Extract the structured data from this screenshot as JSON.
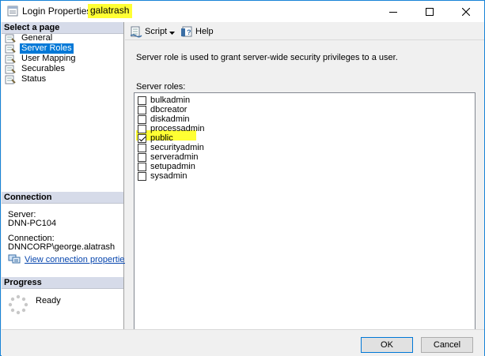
{
  "window": {
    "title": "Login Properties - ",
    "login_name": "galatrash"
  },
  "left_panel": {
    "select_page_header": "Select a page",
    "pages": [
      {
        "label": "General",
        "selected": false
      },
      {
        "label": "Server Roles",
        "selected": true
      },
      {
        "label": "User Mapping",
        "selected": false
      },
      {
        "label": "Securables",
        "selected": false
      },
      {
        "label": "Status",
        "selected": false
      }
    ],
    "connection_header": "Connection",
    "server_label": "Server:",
    "server_value": "DNN-PC104",
    "connection_label": "Connection:",
    "connection_value": "DNNCORP\\george.alatrash",
    "view_connection_link": "View connection properties",
    "progress_header": "Progress",
    "progress_status": "Ready"
  },
  "toolbar": {
    "script_label": "Script",
    "help_label": "Help"
  },
  "main": {
    "description": "Server role is used to grant server-wide security privileges to a user.",
    "roles_label": "Server roles:",
    "roles": [
      {
        "label": "bulkadmin",
        "checked": false
      },
      {
        "label": "dbcreator",
        "checked": false
      },
      {
        "label": "diskadmin",
        "checked": false
      },
      {
        "label": "processadmin",
        "checked": false
      },
      {
        "label": "public",
        "checked": true
      },
      {
        "label": "securityadmin",
        "checked": false
      },
      {
        "label": "serveradmin",
        "checked": false
      },
      {
        "label": "setupadmin",
        "checked": false
      },
      {
        "label": "sysadmin",
        "checked": false
      }
    ]
  },
  "buttons": {
    "ok_label": "OK",
    "cancel_label": "Cancel"
  },
  "colors": {
    "highlight": "#ffff33",
    "selection": "#0078d7",
    "section_header": "#d6dbe9"
  }
}
